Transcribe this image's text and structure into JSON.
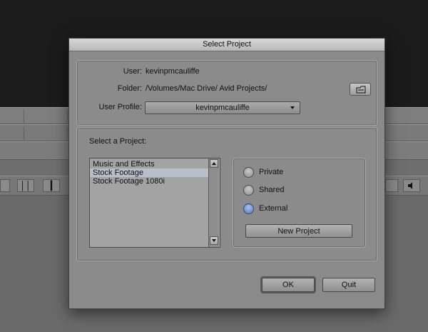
{
  "dialog": {
    "title": "Select Project",
    "user_label": "User:",
    "user_value": "kevinpmcauliffe",
    "folder_label": "Folder:",
    "folder_value": "/Volumes/Mac Drive/ Avid Projects/",
    "profile_label": "User Profile:",
    "profile_value": "kevinpmcauliffe",
    "select_label": "Select a Project:",
    "projects": [
      {
        "name": "Music and Effects",
        "selected": false
      },
      {
        "name": "Stock Footage",
        "selected": true
      },
      {
        "name": "Stock Footage 1080i",
        "selected": false
      }
    ],
    "radios": [
      {
        "label": "Private",
        "checked": false
      },
      {
        "label": "Shared",
        "checked": false
      },
      {
        "label": "External",
        "checked": true
      }
    ],
    "new_project_label": "New Project",
    "ok_label": "OK",
    "quit_label": "Quit"
  },
  "colors": {
    "selection": "#b7bfcb",
    "radio_checked": "#5579b8"
  },
  "icons": {
    "folder_browse": "folder-browse-icon",
    "dropdown_arrow": "chevron-down-icon",
    "scroll_up": "scroll-up-arrow-icon",
    "scroll_down": "scroll-down-arrow-icon",
    "background_buttons": [
      "mark-in-out-icon",
      "mark-clip-icon",
      "speaker-icon"
    ]
  }
}
